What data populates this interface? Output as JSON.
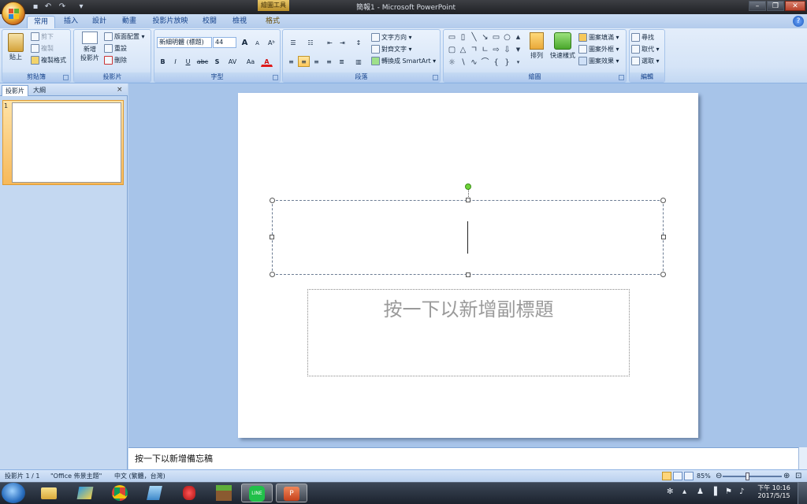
{
  "window": {
    "title": "簡報1 - Microsoft PowerPoint",
    "context_tab": "繪圖工具",
    "qat": {
      "undo_icon": "undo-icon",
      "redo_icon": "redo-icon",
      "save_icon": "save-icon"
    }
  },
  "tabs": [
    "常用",
    "插入",
    "設計",
    "動畫",
    "投影片放映",
    "校閱",
    "檢視",
    "格式"
  ],
  "active_tab": "常用",
  "ribbon": {
    "clipboard": {
      "label": "剪貼簿",
      "paste": "貼上",
      "cut": "剪下",
      "copy": "複製",
      "format_painter": "複製格式"
    },
    "slides": {
      "label": "投影片",
      "new_slide_1": "新增",
      "new_slide_2": "投影片",
      "layout": "版面配置",
      "reset": "重設",
      "delete": "刪除"
    },
    "font": {
      "label": "字型",
      "font_name": "新細明體 (標題)",
      "font_size": "44",
      "bold": "B",
      "italic": "I",
      "underline": "U",
      "strike": "abc",
      "shadow": "S",
      "spacing": "AV",
      "case": "Aa",
      "color": "A",
      "grow": "A",
      "shrink": "A",
      "clear": "Aᵇ"
    },
    "paragraph": {
      "label": "段落",
      "text_direction": "文字方向",
      "align_text": "對齊文字",
      "smartart": "轉換成 SmartArt"
    },
    "drawing": {
      "label": "繪圖",
      "arrange": "排列",
      "quick_styles": "快速樣式",
      "shape_fill": "圖案填滿",
      "shape_outline": "圖案外框",
      "shape_effects": "圖案效果"
    },
    "editing": {
      "label": "編輯",
      "find": "尋找",
      "replace": "取代",
      "select": "選取"
    }
  },
  "pane": {
    "tab_slides": "投影片",
    "tab_outline": "大綱",
    "close": "×",
    "slide_number": "1"
  },
  "slide": {
    "subtitle_placeholder": "按一下以新增副標題"
  },
  "notes": {
    "placeholder": "按一下以新增備忘稿"
  },
  "status": {
    "slide_count": "投影片 1 / 1",
    "theme": "\"Office 佈景主題\"",
    "language": "中文 (繁體，台灣)",
    "zoom": "85%"
  },
  "taskbar": {
    "apps": [
      "file-explorer",
      "app-2",
      "chrome",
      "app-4",
      "app-5",
      "minecraft",
      "line",
      "powerpoint"
    ],
    "clock_time": "下午 10:16",
    "clock_date": "2017/5/15"
  }
}
